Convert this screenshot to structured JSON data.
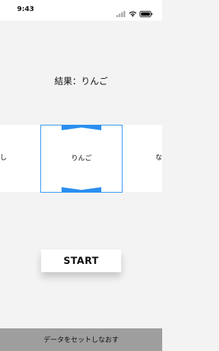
{
  "status_bar": {
    "time": "9:43"
  },
  "result": {
    "text": "結果：りんご"
  },
  "picker": {
    "left_item": "し",
    "selected_item": "りんご",
    "right_item": "な"
  },
  "start_button": {
    "label": "START"
  },
  "bottom_bar": {
    "label": "データをセットしなおす"
  },
  "colors": {
    "accent": "#2a8ff0",
    "background": "#f3f3f3",
    "bottom_bar": "#9e9e9e"
  },
  "icons": [
    "signal-icon",
    "wifi-icon",
    "battery-icon"
  ]
}
